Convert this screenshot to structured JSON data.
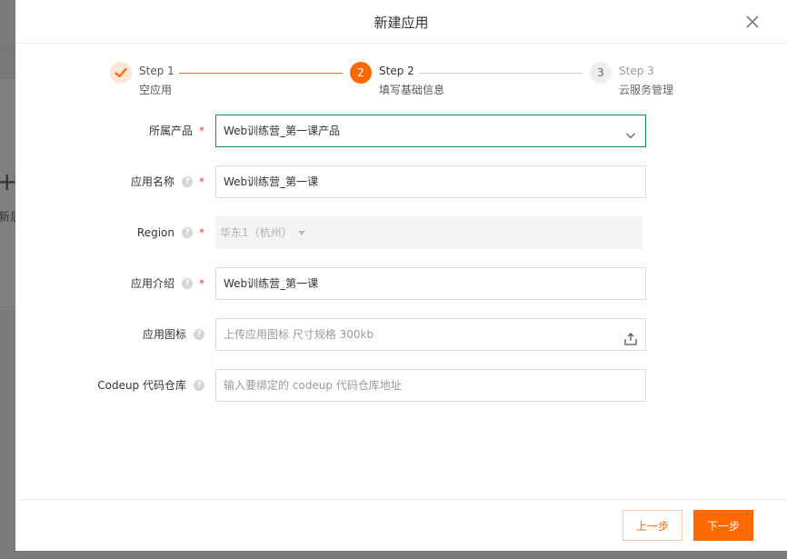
{
  "background": {
    "plus_glyph": "+",
    "card_text": "新后"
  },
  "modal": {
    "title": "新建应用",
    "close_icon": "close-icon"
  },
  "steps": [
    {
      "title": "Step 1",
      "desc": "空应用",
      "state": "done",
      "marker": "check-icon"
    },
    {
      "title": "Step 2",
      "desc": "填写基础信息",
      "state": "current",
      "marker": "2"
    },
    {
      "title": "Step 3",
      "desc": "云服务管理",
      "state": "pending",
      "marker": "3"
    }
  ],
  "form": {
    "product": {
      "label": "所属产品",
      "required": "*",
      "value": "Web训练营_第一课产品"
    },
    "app_name": {
      "label": "应用名称",
      "help": "?",
      "required": "*",
      "value": "Web训练营_第一课"
    },
    "region": {
      "label": "Region",
      "help": "?",
      "required": "*",
      "value": "华东1（杭州）"
    },
    "app_intro": {
      "label": "应用介绍",
      "help": "?",
      "required": "*",
      "value": "Web训练营_第一课"
    },
    "app_icon": {
      "label": "应用图标",
      "help": "?",
      "placeholder": "上传应用图标 尺寸规格 300kb"
    },
    "codeup": {
      "label": "Codeup 代码仓库",
      "help": "?",
      "placeholder": "输入要绑定的 codeup 代码仓库地址"
    }
  },
  "footer": {
    "prev_label": "上一步",
    "next_label": "下一步"
  },
  "colors": {
    "accent": "#ff6a00",
    "focus_border": "#1a8f3c",
    "required": "#e0403a"
  }
}
